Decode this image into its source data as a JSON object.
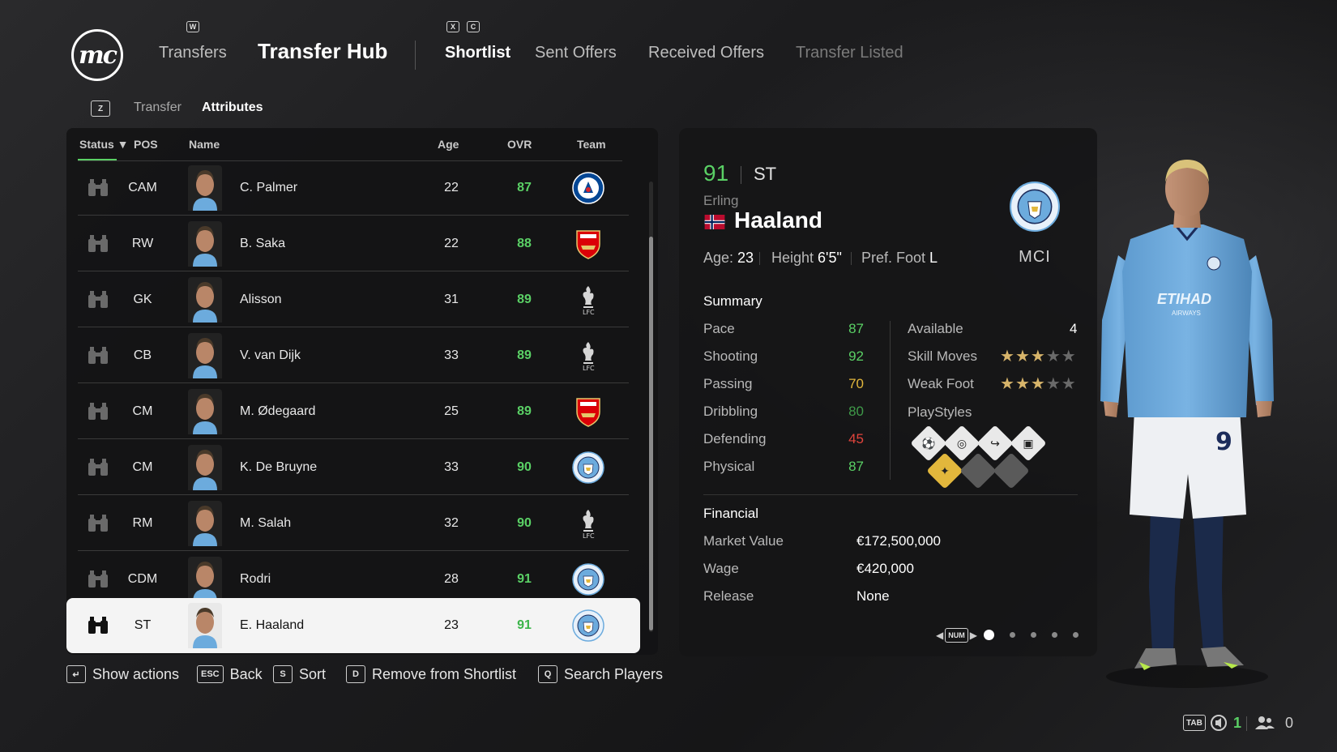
{
  "header": {
    "logo_text": "mc",
    "key_w": "W",
    "key_x": "X",
    "key_c": "C",
    "transfers": "Transfers",
    "hub_title": "Transfer Hub",
    "tabs": [
      "Shortlist",
      "Sent Offers",
      "Received Offers",
      "Transfer Listed"
    ]
  },
  "subnav": {
    "key": "Z",
    "items": [
      "Transfer",
      "Attributes"
    ]
  },
  "table": {
    "columns": [
      "Status",
      "POS",
      "Name",
      "Age",
      "OVR",
      "Team"
    ],
    "rows": [
      {
        "pos": "CAM",
        "name": "C. Palmer",
        "age": "22",
        "ovr": "87",
        "team_icon": "chelsea-badge-icon"
      },
      {
        "pos": "RW",
        "name": "B. Saka",
        "age": "22",
        "ovr": "88",
        "team_icon": "arsenal-badge-icon"
      },
      {
        "pos": "GK",
        "name": "Alisson",
        "age": "31",
        "ovr": "89",
        "team_icon": "liverpool-badge-icon"
      },
      {
        "pos": "CB",
        "name": "V. van Dijk",
        "age": "33",
        "ovr": "89",
        "team_icon": "liverpool-badge-icon"
      },
      {
        "pos": "CM",
        "name": "M. Ødegaard",
        "age": "25",
        "ovr": "89",
        "team_icon": "arsenal-badge-icon"
      },
      {
        "pos": "CM",
        "name": "K. De Bruyne",
        "age": "33",
        "ovr": "90",
        "team_icon": "mancity-badge-icon"
      },
      {
        "pos": "RM",
        "name": "M. Salah",
        "age": "32",
        "ovr": "90",
        "team_icon": "liverpool-badge-icon"
      },
      {
        "pos": "CDM",
        "name": "Rodri",
        "age": "28",
        "ovr": "91",
        "team_icon": "mancity-badge-icon"
      },
      {
        "pos": "ST",
        "name": "E. Haaland",
        "age": "23",
        "ovr": "91",
        "team_icon": "mancity-badge-icon"
      }
    ],
    "selected_index": 8
  },
  "actions": [
    {
      "key": "↵",
      "label": "Show actions"
    },
    {
      "key": "ESC",
      "label": "Back"
    },
    {
      "key": "S",
      "label": "Sort"
    },
    {
      "key": "D",
      "label": "Remove from Shortlist"
    },
    {
      "key": "Q",
      "label": "Search Players"
    }
  ],
  "player": {
    "ovr": "91",
    "pos": "ST",
    "first_name": "Erling",
    "last_name": "Haaland",
    "age_label": "Age:",
    "age": "23",
    "height_label": "Height",
    "height": "6'5\"",
    "foot_label": "Pref. Foot",
    "foot": "L",
    "club": "MCI",
    "nation_flag": "norway-flag-icon",
    "summary_title": "Summary",
    "stats": [
      {
        "label": "Pace",
        "value": "87",
        "color": "#5ad065"
      },
      {
        "label": "Shooting",
        "value": "92",
        "color": "#5ad065"
      },
      {
        "label": "Passing",
        "value": "70",
        "color": "#e2b73c"
      },
      {
        "label": "Dribbling",
        "value": "80",
        "color": "#3f9a49"
      },
      {
        "label": "Defending",
        "value": "45",
        "color": "#e0443c"
      },
      {
        "label": "Physical",
        "value": "87",
        "color": "#5ad065"
      }
    ],
    "available_label": "Available",
    "available_value": "4",
    "skill_moves_label": "Skill Moves",
    "skill_moves": 3,
    "weak_foot_label": "Weak Foot",
    "weak_foot": 3,
    "playstyles_label": "PlayStyles",
    "financial_title": "Financial",
    "financial": [
      {
        "label": "Market Value",
        "value": "€172,500,000"
      },
      {
        "label": "Wage",
        "value": "€420,000"
      },
      {
        "label": "Release",
        "value": "None"
      }
    ],
    "pager_key": "NUM",
    "page_count": 5,
    "page_current": 1
  },
  "footer": {
    "key": "TAB",
    "count_a": "1",
    "count_b": "0"
  },
  "colors": {
    "accent_green": "#5ad065",
    "star_gold": "#d7b46a"
  }
}
